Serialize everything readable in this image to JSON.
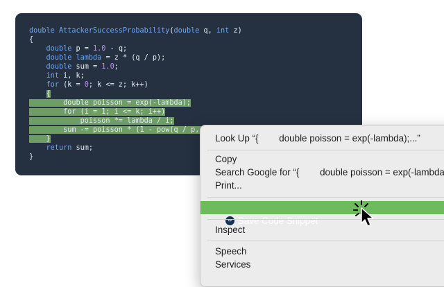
{
  "code_lines": [
    [
      {
        "t": "double ",
        "c": "kw"
      },
      {
        "t": "AttackerSuccessProbability",
        "c": "fn"
      },
      {
        "t": "("
      },
      {
        "t": "double",
        "c": "kw"
      },
      {
        "t": " q, "
      },
      {
        "t": "int",
        "c": "kw"
      },
      {
        "t": " z)"
      }
    ],
    [
      {
        "t": "{"
      }
    ],
    [
      {
        "t": "    "
      },
      {
        "t": "double",
        "c": "kw"
      },
      {
        "t": " p = "
      },
      {
        "t": "1.0",
        "c": "num"
      },
      {
        "t": " - q;"
      }
    ],
    [
      {
        "t": "    "
      },
      {
        "t": "double",
        "c": "kw"
      },
      {
        "t": " "
      },
      {
        "t": "lambda",
        "c": "fn"
      },
      {
        "t": " = z * (q / p);"
      }
    ],
    [
      {
        "t": "    "
      },
      {
        "t": "double",
        "c": "kw"
      },
      {
        "t": " sum = "
      },
      {
        "t": "1.0",
        "c": "num"
      },
      {
        "t": ";"
      }
    ],
    [
      {
        "t": "    "
      },
      {
        "t": "int",
        "c": "kw"
      },
      {
        "t": " i, k;"
      }
    ],
    [
      {
        "t": "    "
      },
      {
        "t": "for",
        "c": "kw"
      },
      {
        "t": " (k = "
      },
      {
        "t": "0",
        "c": "num"
      },
      {
        "t": "; k <= z; k++)"
      }
    ],
    [
      {
        "t": "    "
      },
      {
        "t": "{",
        "sel": true
      }
    ],
    [
      {
        "t": "        double poisson = exp(-lambda);",
        "sel": true
      }
    ],
    [
      {
        "t": "        for (i = 1; i <= k; i++)",
        "sel": true
      }
    ],
    [
      {
        "t": "            poisson *= lambda / i;",
        "sel": true
      }
    ],
    [
      {
        "t": "        sum -= poisson * (1 - pow(q / p, z - k));",
        "sel": true
      }
    ],
    [
      {
        "t": "    }",
        "sel": true
      }
    ],
    [
      {
        "t": "    "
      },
      {
        "t": "return",
        "c": "kw"
      },
      {
        "t": " sum;"
      }
    ],
    [
      {
        "t": "}"
      }
    ]
  ],
  "menu": {
    "look_up": "Look Up “{        double poisson = exp(-lambda);...”",
    "copy": "Copy",
    "search_google": "Search Google for “{        double poisson = exp(-lambda);...”",
    "print": "Print...",
    "save_snippet": "Save Code Snippet",
    "inspect": "Inspect",
    "speech": "Speech",
    "services": "Services"
  },
  "colors": {
    "code_bg": "#253141",
    "selection": "#6f9d66",
    "menu_highlight": "#6dbb5c",
    "keyword": "#6ea6f4",
    "number": "#c58af0"
  },
  "icons": {
    "snippet": "code-brackets-icon",
    "cursor": "pointer-click-cursor-icon"
  }
}
